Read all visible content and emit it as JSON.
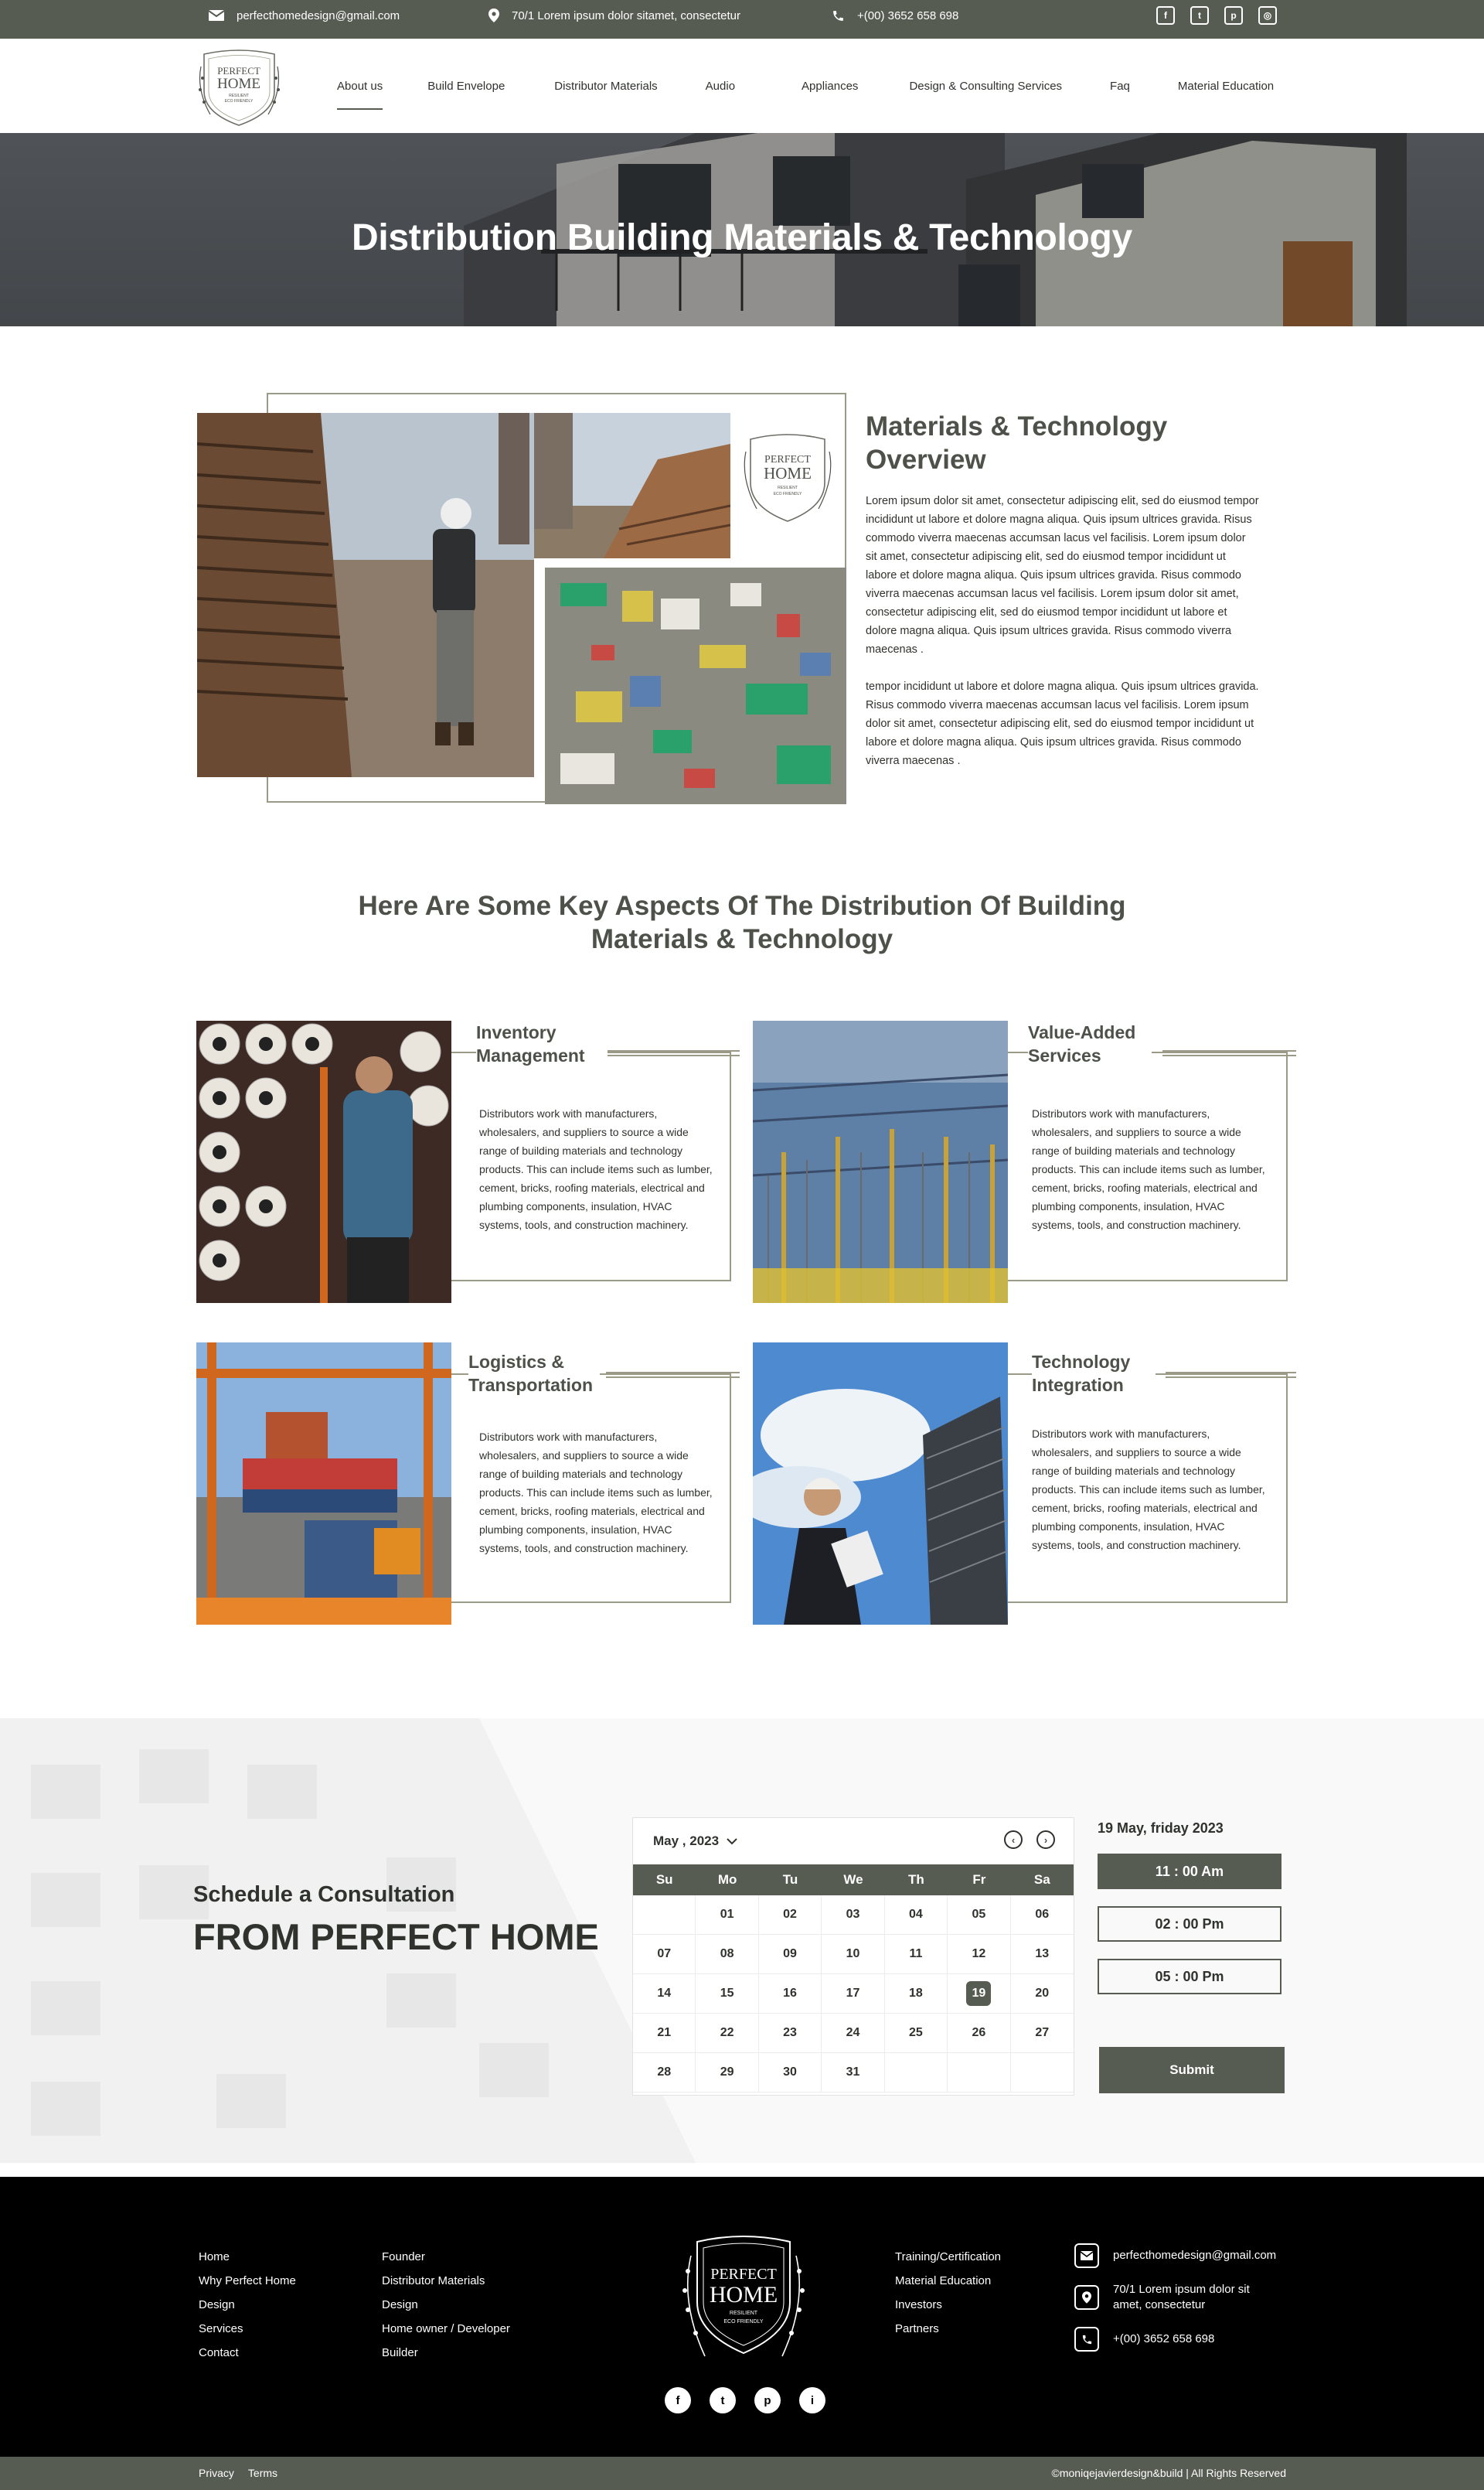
{
  "topbar": {
    "email": "perfecthomedesign@gmail.com",
    "address": "70/1 Lorem ipsum dolor sitamet, consectetur",
    "phone": "+(00) 3652 658 698",
    "social": [
      "facebook-icon",
      "twitter-icon",
      "pinterest-icon",
      "instagram-icon"
    ]
  },
  "logo": {
    "line1": "PERFECT",
    "line2": "HOME",
    "tag1": "RESILIENT",
    "tag2": "ECO FRIENDLY"
  },
  "nav": {
    "items": [
      {
        "label": "About us",
        "active": true
      },
      {
        "label": "Build Envelope"
      },
      {
        "label": "Distributor Materials"
      },
      {
        "label": "Audio"
      },
      {
        "label": "Appliances"
      },
      {
        "label": "Design & Consulting Services"
      },
      {
        "label": "Faq"
      },
      {
        "label": "Material Education"
      }
    ]
  },
  "hero": {
    "title": "Distribution Building Materials & Technology"
  },
  "overview": {
    "title": "Materials & Technology Overview",
    "paragraphs": [
      "Lorem ipsum dolor sit amet, consectetur adipiscing elit, sed do eiusmod tempor incididunt ut labore et dolore magna aliqua. Quis ipsum ultrices gravida. Risus commodo viverra maecenas accumsan lacus vel facilisis.  Lorem ipsum dolor sit amet, consectetur adipiscing elit, sed do eiusmod tempor incididunt ut labore et dolore magna aliqua. Quis ipsum ultrices gravida. Risus commodo viverra maecenas accumsan lacus vel facilisis. Lorem ipsum dolor sit amet, consectetur adipiscing elit, sed do eiusmod tempor incididunt ut labore et dolore magna aliqua. Quis ipsum ultrices gravida. Risus commodo viverra maecenas .",
      "tempor incididunt ut labore et dolore magna aliqua. Quis ipsum ultrices gravida. Risus commodo viverra maecenas accumsan lacus vel facilisis. Lorem ipsum dolor sit amet, consectetur adipiscing elit, sed do eiusmod tempor incididunt ut labore et dolore magna aliqua. Quis ipsum ultrices gravida. Risus commodo viverra maecenas ."
    ]
  },
  "aspects": {
    "title": "Here Are Some Key Aspects Of The Distribution Of Building Materials & Technology",
    "cards": [
      {
        "title": "Inventory Management",
        "text": "Distributors work with manufacturers, wholesalers, and suppliers to source a wide range of building materials and technology products. This can include items such as lumber, cement, bricks, roofing materials, electrical and plumbing components, insulation, HVAC systems, tools, and construction machinery."
      },
      {
        "title": "Value-Added Services",
        "text": "Distributors work with manufacturers, wholesalers, and suppliers to source a wide range of building materials and technology products. This can include items such as lumber, cement, bricks, roofing materials, electrical and plumbing components, insulation, HVAC systems, tools, and construction machinery."
      },
      {
        "title": "Logistics & Transportation",
        "text": "Distributors work with manufacturers, wholesalers, and suppliers to source a wide range of building materials and technology products. This can include items such as lumber, cement, bricks, roofing materials, electrical and plumbing components, insulation, HVAC systems, tools, and construction machinery."
      },
      {
        "title": "Technology Integration",
        "text": "Distributors work with manufacturers, wholesalers, and suppliers to source a wide range of building materials and technology products. This can include items such as lumber, cement, bricks, roofing materials, electrical and plumbing components, insulation, HVAC systems, tools, and construction machinery."
      }
    ]
  },
  "schedule": {
    "line1": "Schedule a Consultation",
    "line2": "FROM PERFECT HOME",
    "month": "May , 2023",
    "dow": [
      "Su",
      "Mo",
      "Tu",
      "We",
      "Th",
      "Fr",
      "Sa"
    ],
    "days": [
      "",
      "01",
      "02",
      "03",
      "04",
      "05",
      "06",
      "07",
      "08",
      "09",
      "10",
      "11",
      "12",
      "13",
      "14",
      "15",
      "16",
      "17",
      "18",
      "19",
      "20",
      "21",
      "22",
      "23",
      "24",
      "25",
      "26",
      "27",
      "28",
      "29",
      "30",
      "31",
      "",
      "",
      ""
    ],
    "selected": "19",
    "selected_date": "19 May, friday  2023",
    "slots": [
      "11 : 00 Am",
      "02 : 00 Pm",
      "05 : 00 Pm"
    ],
    "active_slot": "11 : 00 Am",
    "submit": "Submit"
  },
  "footer": {
    "col1": [
      "Home",
      "Why Perfect Home",
      "Design",
      "Services",
      "Contact"
    ],
    "col2": [
      "Founder",
      "Distributor Materials",
      "Design",
      "Home owner / Developer",
      "Builder"
    ],
    "col3": [
      "Training/Certification",
      "Material Education",
      "Investors",
      "Partners"
    ],
    "email": "perfecthomedesign@gmail.com",
    "address": "70/1 Lorem ipsum dolor sit amet, consectetur",
    "phone": "+(00) 3652 658 698",
    "social_glyphs": [
      "f",
      "t",
      "p",
      "i"
    ]
  },
  "bottom": {
    "privacy": "Privacy",
    "terms": "Terms",
    "copyright": "©moniqejavierdesign&build | All Rights Reserved"
  },
  "colors": {
    "accent": "#575c52",
    "border": "#9a9a87",
    "text": "#2f322d"
  }
}
